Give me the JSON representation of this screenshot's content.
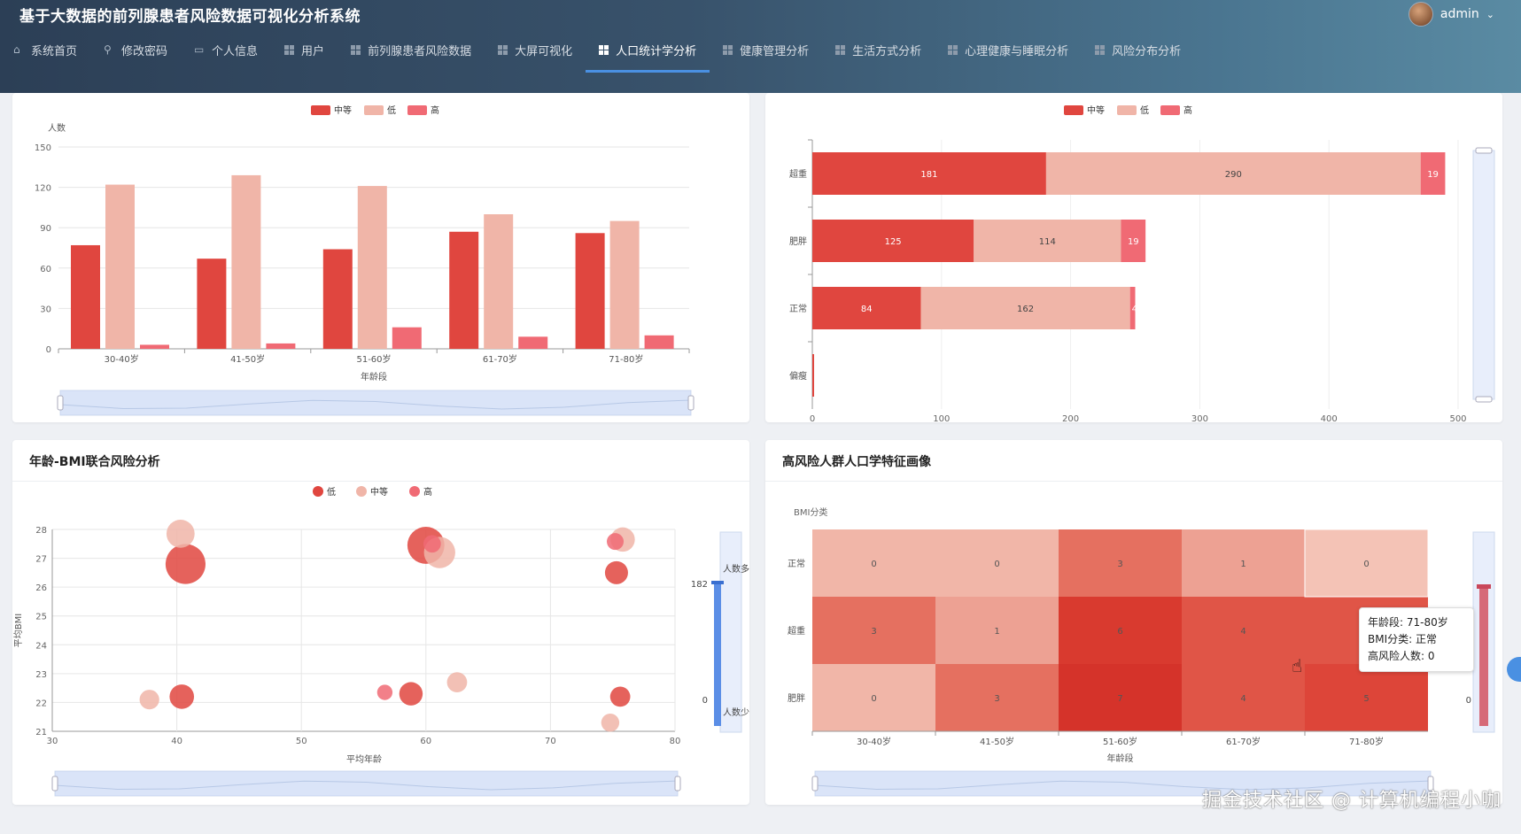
{
  "app": {
    "title": "基于大数据的前列腺患者风险数据可视化分析系统",
    "user": "admin"
  },
  "nav": [
    {
      "label": "系统首页",
      "icon": "home-icon"
    },
    {
      "label": "修改密码",
      "icon": "lock-icon"
    },
    {
      "label": "个人信息",
      "icon": "id-card-icon"
    },
    {
      "label": "用户",
      "icon": "grid-icon"
    },
    {
      "label": "前列腺患者风险数据",
      "icon": "grid-icon"
    },
    {
      "label": "大屏可视化",
      "icon": "grid-icon"
    },
    {
      "label": "人口统计学分析",
      "icon": "grid-icon",
      "active": true
    },
    {
      "label": "健康管理分析",
      "icon": "grid-icon"
    },
    {
      "label": "生活方式分析",
      "icon": "grid-icon"
    },
    {
      "label": "心理健康与睡眠分析",
      "icon": "grid-icon"
    },
    {
      "label": "风险分布分析",
      "icon": "grid-icon"
    }
  ],
  "colors": {
    "medium": "#e0463f",
    "low": "#f0b5a8",
    "high": "#f06a74",
    "accent": "#4a90e2"
  },
  "chart_data": [
    {
      "type": "bar",
      "legend": [
        "中等",
        "低",
        "高"
      ],
      "categories": [
        "30-40岁",
        "41-50岁",
        "51-60岁",
        "61-70岁",
        "71-80岁"
      ],
      "series": [
        {
          "name": "中等",
          "values": [
            77,
            67,
            74,
            87,
            86
          ]
        },
        {
          "name": "低",
          "values": [
            122,
            129,
            121,
            100,
            95
          ]
        },
        {
          "name": "高",
          "values": [
            3,
            4,
            16,
            9,
            10
          ]
        }
      ],
      "ylabel": "人数",
      "xlabel": "年龄段",
      "ylim": [
        0,
        150
      ],
      "yticks": [
        0,
        30,
        60,
        90,
        120,
        150
      ],
      "grid": true,
      "legend_position": "top-center"
    },
    {
      "type": "bar",
      "orientation": "horizontal-stacked",
      "legend": [
        "中等",
        "低",
        "高"
      ],
      "categories": [
        "超重",
        "肥胖",
        "正常",
        "偏瘦"
      ],
      "series": [
        {
          "name": "中等",
          "values": [
            181,
            125,
            84,
            0
          ]
        },
        {
          "name": "低",
          "values": [
            290,
            114,
            162,
            0
          ]
        },
        {
          "name": "高",
          "values": [
            19,
            19,
            4,
            0
          ]
        }
      ],
      "labels": {
        "medium": [
          "181",
          "125",
          "84",
          "0"
        ],
        "low": [
          "290",
          "114",
          "162",
          ""
        ],
        "high": [
          "19",
          "19",
          "4",
          ""
        ]
      },
      "xlim": [
        0,
        500
      ],
      "xticks": [
        0,
        100,
        200,
        300,
        400,
        500
      ],
      "legend_position": "top-center"
    },
    {
      "type": "scatter",
      "title": "年龄-BMI联合风险分析",
      "legend": [
        "低",
        "中等",
        "高"
      ],
      "xlabel": "平均年龄",
      "ylabel": "平均BMI",
      "xlim": [
        30,
        80
      ],
      "ylim": [
        21,
        28
      ],
      "xticks": [
        30,
        40,
        50,
        60,
        70,
        80
      ],
      "yticks": [
        21,
        22,
        23,
        24,
        25,
        26,
        27,
        28
      ],
      "points": [
        {
          "x": 40.3,
          "y": 27.85,
          "size": 70,
          "risk": "低"
        },
        {
          "x": 40.7,
          "y": 26.8,
          "size": 182,
          "risk": "中等"
        },
        {
          "x": 60.0,
          "y": 27.45,
          "size": 150,
          "risk": "中等"
        },
        {
          "x": 61.1,
          "y": 27.2,
          "size": 95,
          "risk": "低"
        },
        {
          "x": 60.5,
          "y": 27.5,
          "size": 14,
          "risk": "高"
        },
        {
          "x": 75.8,
          "y": 27.65,
          "size": 45,
          "risk": "低"
        },
        {
          "x": 75.2,
          "y": 27.58,
          "size": 12,
          "risk": "高"
        },
        {
          "x": 75.3,
          "y": 26.5,
          "size": 38,
          "risk": "中等"
        },
        {
          "x": 37.8,
          "y": 22.1,
          "size": 22,
          "risk": "低"
        },
        {
          "x": 40.4,
          "y": 22.2,
          "size": 46,
          "risk": "中等"
        },
        {
          "x": 56.7,
          "y": 22.35,
          "size": 8,
          "risk": "高"
        },
        {
          "x": 58.8,
          "y": 22.3,
          "size": 40,
          "risk": "中等"
        },
        {
          "x": 62.5,
          "y": 22.7,
          "size": 24,
          "risk": "低"
        },
        {
          "x": 75.6,
          "y": 22.2,
          "size": 24,
          "risk": "中等"
        },
        {
          "x": 74.8,
          "y": 21.3,
          "size": 16,
          "risk": "低"
        }
      ],
      "visual_map": {
        "max_label": "182",
        "min_label": "0",
        "top_label": "人数多",
        "bottom_label": "人数少"
      },
      "legend_position": "top-center"
    },
    {
      "type": "heatmap",
      "title": "高风险人群人口学特征画像",
      "xlabel": "年龄段",
      "ylabel": "BMI分类",
      "x": [
        "30-40岁",
        "41-50岁",
        "51-60岁",
        "61-70岁",
        "71-80岁"
      ],
      "y": [
        "正常",
        "超重",
        "肥胖"
      ],
      "values": [
        [
          0,
          0,
          3,
          1,
          0
        ],
        [
          3,
          1,
          6,
          4,
          4
        ],
        [
          0,
          3,
          7,
          4,
          5
        ]
      ],
      "tooltip": {
        "line1": "年龄段: 71-80岁",
        "line2": "BMI分类: 正常",
        "line3": "高风险人数: 0"
      },
      "visual_map": {
        "min_label": "0"
      }
    }
  ],
  "watermark": "掘金技术社区 @ 计算机编程小咖"
}
